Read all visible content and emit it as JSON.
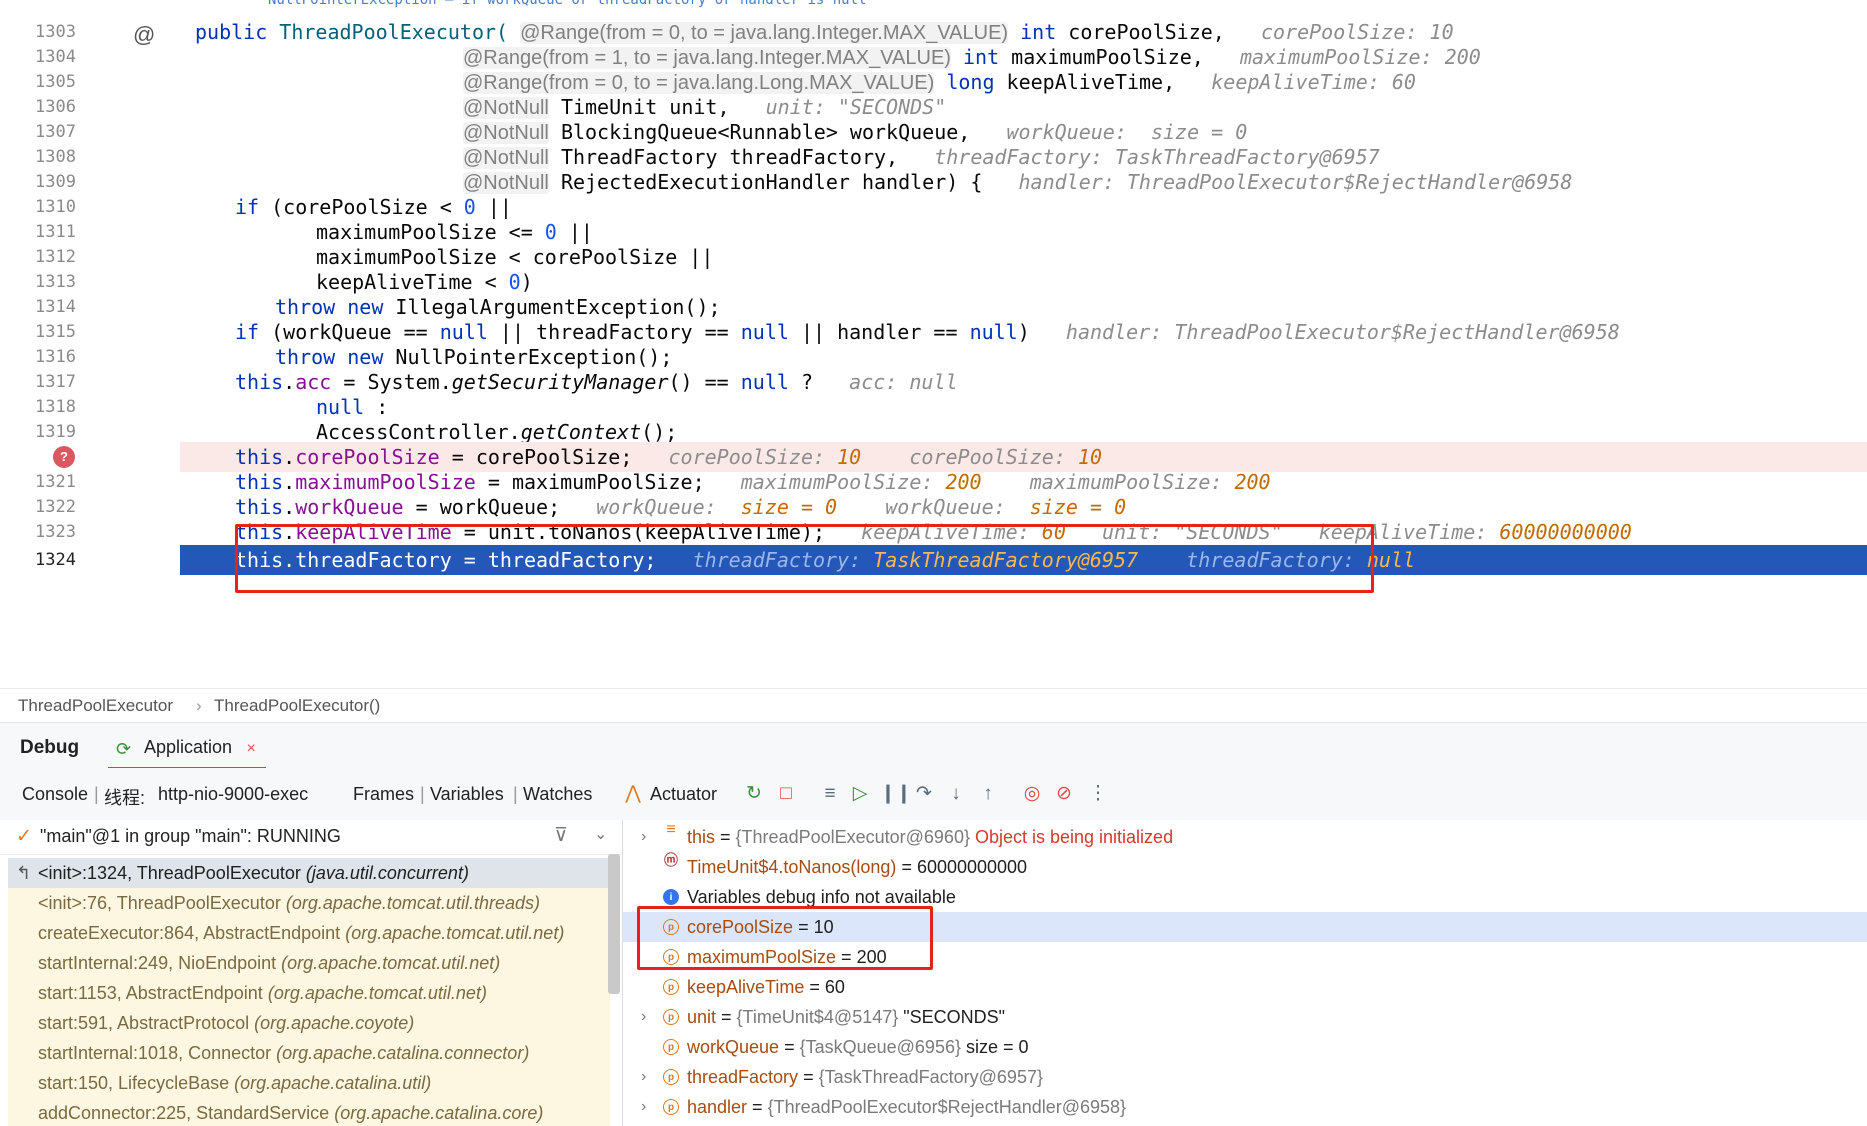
{
  "editor": {
    "top_text": "NullPointerException — if workQueue or threadFactory or handler is null",
    "lines": [
      {
        "n": "1303",
        "code": "public ThreadPoolExecutor(",
        "ann": "@Range(from = 0, to = java.lang.Integer.MAX_VALUE)",
        "rest": "int corePoolSize,",
        "hint": "corePoolSize: 10"
      },
      {
        "n": "1304",
        "ann": "@Range(from = 1, to = java.lang.Integer.MAX_VALUE)",
        "rest": "int maximumPoolSize,",
        "hint": "maximumPoolSize: 200"
      },
      {
        "n": "1305",
        "ann": "@Range(from = 0, to = java.lang.Long.MAX_VALUE)",
        "rest": "long keepAliveTime,",
        "hint": "keepAliveTime: 60"
      },
      {
        "n": "1306",
        "ann": "@NotNull",
        "rest": "TimeUnit unit,",
        "hint": "unit: \"SECONDS\""
      },
      {
        "n": "1307",
        "ann": "@NotNull",
        "rest": "BlockingQueue<Runnable> workQueue,",
        "hint": "workQueue:  size = 0"
      },
      {
        "n": "1308",
        "ann": "@NotNull",
        "rest": "ThreadFactory threadFactory,",
        "hint": "threadFactory: TaskThreadFactory@6957"
      },
      {
        "n": "1309",
        "ann": "@NotNull",
        "rest": "RejectedExecutionHandler handler) {",
        "hint": "handler: ThreadPoolExecutor$RejectHandler@6958"
      },
      {
        "n": "1310",
        "code": "if (corePoolSize < 0 ||"
      },
      {
        "n": "1311",
        "code": "maximumPoolSize <= 0 ||"
      },
      {
        "n": "1312",
        "code": "maximumPoolSize < corePoolSize ||"
      },
      {
        "n": "1313",
        "code": "keepAliveTime < 0)"
      },
      {
        "n": "1314",
        "code": "throw new IllegalArgumentException();"
      },
      {
        "n": "1315",
        "code": "if (workQueue == null || threadFactory == null || handler == null)",
        "hint": "handler: ThreadPoolExecutor$RejectHandler@6958"
      },
      {
        "n": "1316",
        "code": "throw new NullPointerException();"
      },
      {
        "n": "1317",
        "code": "this.acc = System.getSecurityManager() == null ?",
        "hint": "acc: null"
      },
      {
        "n": "1318",
        "code": "null :"
      },
      {
        "n": "1319",
        "code": "AccessController.getContext();"
      },
      {
        "n": "",
        "code": "this.corePoolSize = corePoolSize;",
        "hint1": "corePoolSize:",
        "val1": "10",
        "hint2": "corePoolSize:",
        "val2": "10"
      },
      {
        "n": "1321",
        "code": "this.maximumPoolSize = maximumPoolSize;",
        "hint1": "maximumPoolSize:",
        "val1": "200",
        "hint2": "maximumPoolSize:",
        "val2": "200"
      },
      {
        "n": "1322",
        "code": "this.workQueue = workQueue;",
        "hint1": "workQueue:",
        "val1": "size = 0",
        "hint2": "workQueue:",
        "val2": "size = 0"
      },
      {
        "n": "1323",
        "code": "this.keepAliveTime = unit.toNanos(keepAliveTime);",
        "hint1": "keepAliveTime:",
        "val1": "60",
        "hint2": "unit: \"SECONDS\"",
        "hint3": "keepAliveTime:",
        "val3": "60000000000"
      },
      {
        "n": "1324",
        "code": "this.threadFactory = threadFactory;",
        "hint1": "threadFactory:",
        "val1": "TaskThreadFactory@6957",
        "hint2": "threadFactory:",
        "val2": "null"
      }
    ]
  },
  "breadcrumb": [
    "ThreadPoolExecutor",
    "ThreadPoolExecutor()"
  ],
  "debug": {
    "title": "Debug",
    "tab_label": "Application",
    "tab_close": "×",
    "toolbar": {
      "console": "Console",
      "thread": "线程:",
      "thread_name": "http-nio-9000-exec",
      "frames": "Frames",
      "variables": "Variables",
      "watches": "Watches",
      "actuator": "Actuator"
    }
  },
  "thread": "\"main\"@1 in group \"main\": RUNNING",
  "frames": [
    {
      "method": "<init>:1324, ThreadPoolExecutor",
      "pkg": "(java.util.concurrent)"
    },
    {
      "method": "<init>:76, ThreadPoolExecutor",
      "pkg": "(org.apache.tomcat.util.threads)"
    },
    {
      "method": "createExecutor:864, AbstractEndpoint",
      "pkg": "(org.apache.tomcat.util.net)"
    },
    {
      "method": "startInternal:249, NioEndpoint",
      "pkg": "(org.apache.tomcat.util.net)"
    },
    {
      "method": "start:1153, AbstractEndpoint",
      "pkg": "(org.apache.tomcat.util.net)"
    },
    {
      "method": "start:591, AbstractProtocol",
      "pkg": "(org.apache.coyote)"
    },
    {
      "method": "startInternal:1018, Connector",
      "pkg": "(org.apache.catalina.connector)"
    },
    {
      "method": "start:150, LifecycleBase",
      "pkg": "(org.apache.catalina.util)"
    },
    {
      "method": "addConnector:225, StandardService",
      "pkg": "(org.apache.catalina.core)"
    }
  ],
  "variables": [
    {
      "name": "this",
      "eq": " = ",
      "type": "{ThreadPoolExecutor@6960}",
      "extra": " Object is being initialized"
    },
    {
      "name": "TimeUnit$4.toNanos(long)",
      "eq": " = ",
      "val": "60000000000"
    },
    {
      "name": "",
      "val": "Variables debug info not available"
    },
    {
      "name": "corePoolSize",
      "eq": " = ",
      "val": "10"
    },
    {
      "name": "maximumPoolSize",
      "eq": " = ",
      "val": "200"
    },
    {
      "name": "keepAliveTime",
      "eq": " = ",
      "val": "60"
    },
    {
      "name": "unit",
      "eq": " = ",
      "type": "{TimeUnit$4@5147}",
      "val": " \"SECONDS\""
    },
    {
      "name": "workQueue",
      "eq": " = ",
      "type": "{TaskQueue@6956}",
      "val": "  size = 0"
    },
    {
      "name": "threadFactory",
      "eq": " = ",
      "type": "{TaskThreadFactory@6957}"
    },
    {
      "name": "handler",
      "eq": " = ",
      "type": "{ThreadPoolExecutor$RejectHandler@6958}"
    }
  ],
  "icons": {
    "at": "@",
    "breakpoint": "?",
    "check": "✓",
    "filter": "⊽",
    "chevron": "⌄"
  },
  "colors": {
    "highlight": "#e8221b",
    "selection": "#2458b8",
    "accent": "#3574f0"
  }
}
